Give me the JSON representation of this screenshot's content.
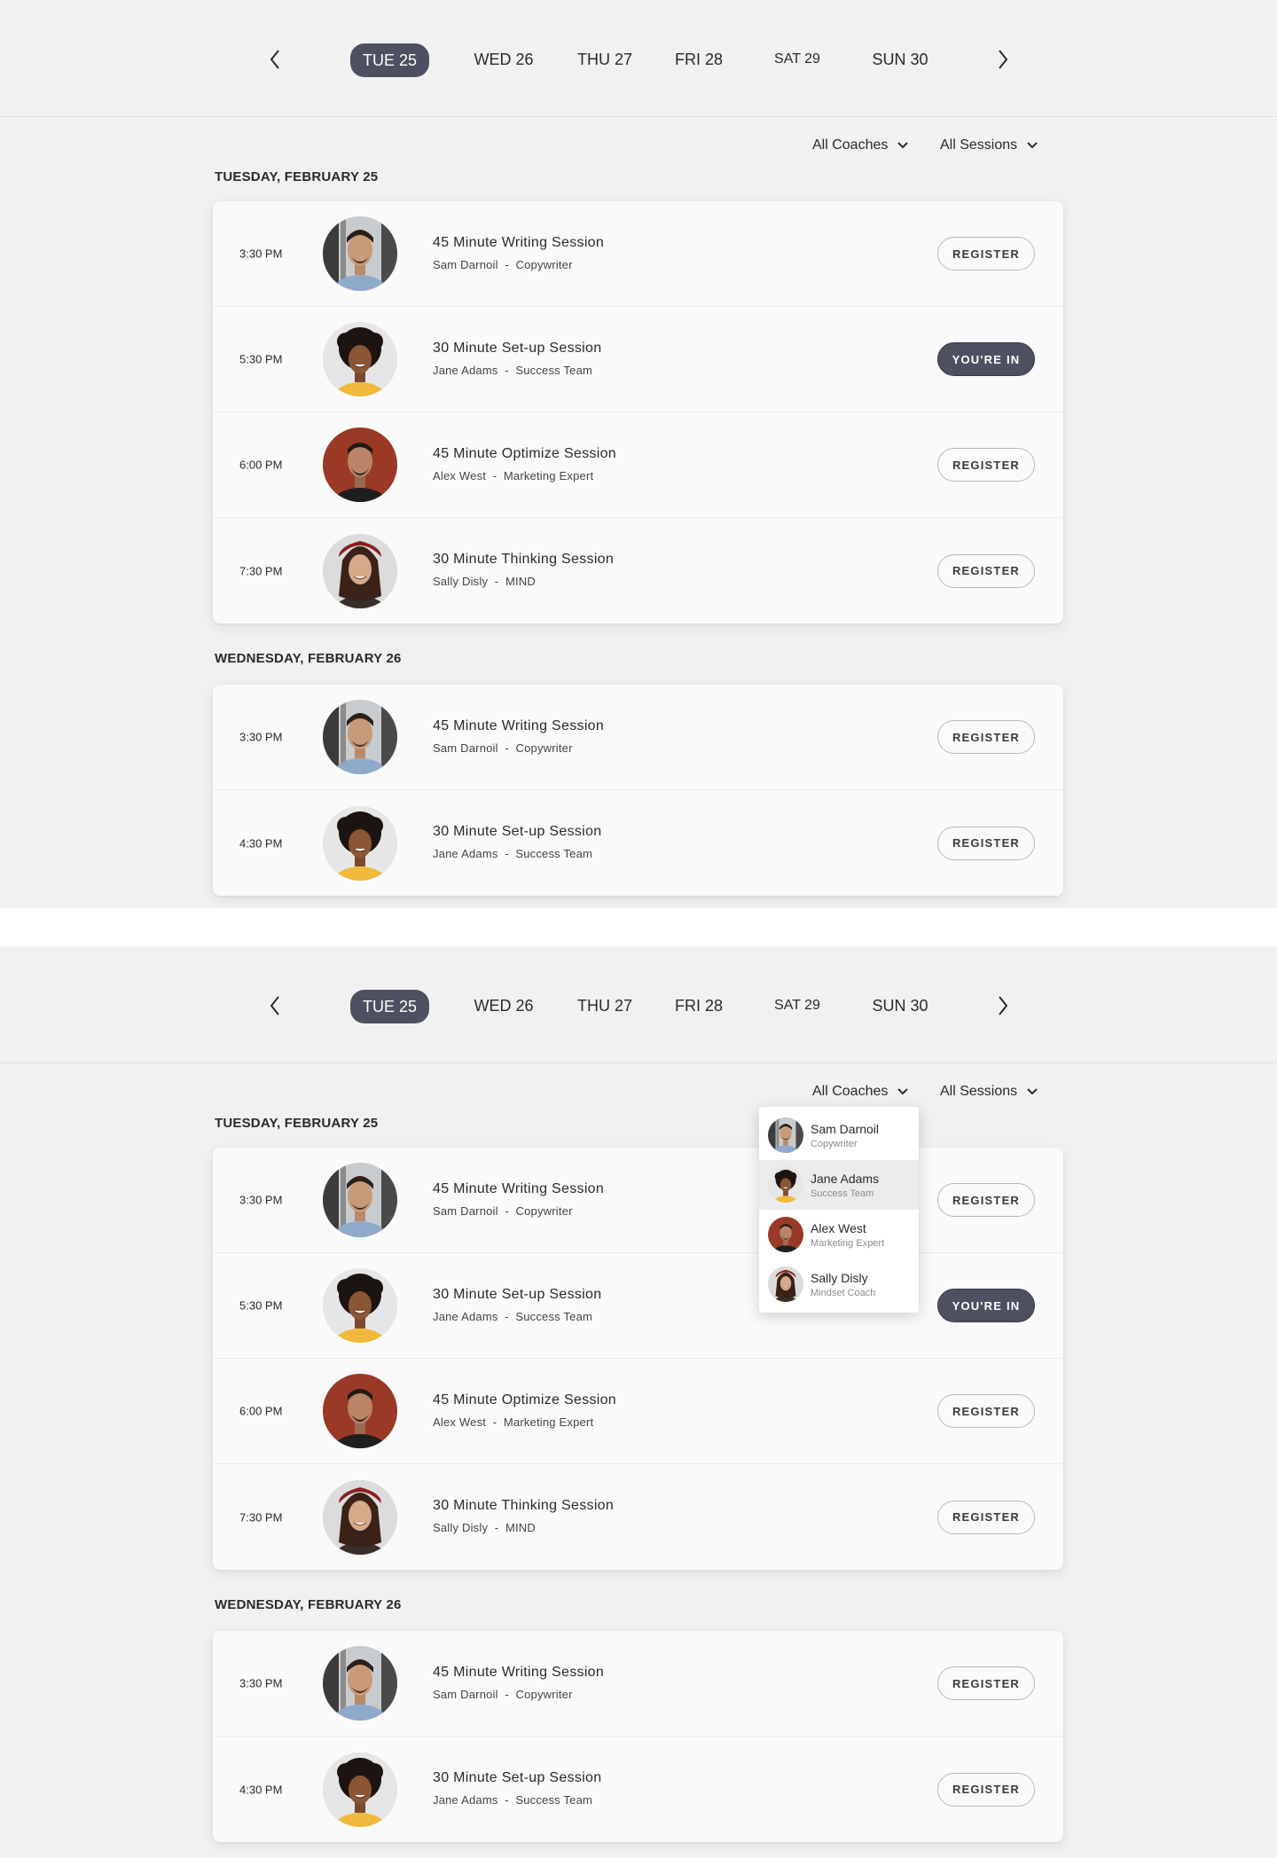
{
  "day_nav": {
    "days": [
      "TUE 25",
      "WED 26",
      "THU 27",
      "FRI 28",
      "SAT 29",
      "SUN 30"
    ],
    "active_index": 0
  },
  "filters": {
    "coaches_label": "All Coaches",
    "sessions_label": "All Sessions"
  },
  "schedule": [
    {
      "heading": "TUESDAY, FEBRUARY 25",
      "sessions": [
        {
          "time": "3:30 PM",
          "title": "45 Minute Writing Session",
          "coach": "Sam Darnoil",
          "sep": "-",
          "role": "Copywriter",
          "action": "REGISTER",
          "state": "register",
          "avatar": "sam"
        },
        {
          "time": "5:30 PM",
          "title": "30 Minute Set-up Session",
          "coach": "Jane Adams",
          "sep": "-",
          "role": "Success Team",
          "action": "YOU'RE IN",
          "state": "in",
          "avatar": "jane"
        },
        {
          "time": "6:00 PM",
          "title": "45 Minute Optimize Session",
          "coach": "Alex West",
          "sep": "-",
          "role": "Marketing Expert",
          "action": "REGISTER",
          "state": "register",
          "avatar": "alex"
        },
        {
          "time": "7:30 PM",
          "title": "30 Minute Thinking Session",
          "coach": "Sally Disly",
          "sep": "-",
          "role": "MIND",
          "action": "REGISTER",
          "state": "register",
          "avatar": "sally"
        }
      ]
    },
    {
      "heading": "WEDNESDAY, FEBRUARY 26",
      "sessions": [
        {
          "time": "3:30 PM",
          "title": "45 Minute Writing Session",
          "coach": "Sam Darnoil",
          "sep": "-",
          "role": "Copywriter",
          "action": "REGISTER",
          "state": "register",
          "avatar": "sam"
        },
        {
          "time": "4:30 PM",
          "title": "30 Minute Set-up Session",
          "coach": "Jane Adams",
          "sep": "-",
          "role": "Success Team",
          "action": "REGISTER",
          "state": "register",
          "avatar": "jane"
        }
      ]
    }
  ],
  "coach_dropdown": {
    "items": [
      {
        "name": "Sam Darnoil",
        "role": "Copywriter",
        "avatar": "sam"
      },
      {
        "name": "Jane Adams",
        "role": "Success Team",
        "avatar": "jane"
      },
      {
        "name": "Alex West",
        "role": "Marketing Expert",
        "avatar": "alex"
      },
      {
        "name": "Sally Disly",
        "role": "Mindset Coach",
        "avatar": "sally"
      }
    ],
    "hover_index": 1
  },
  "icons": {
    "prev": "chevron-left-icon",
    "next": "chevron-right-icon",
    "dropdown": "chevron-down-icon"
  },
  "colors": {
    "active_pill": "#4d5060",
    "page_bg": "#f1f1f2",
    "card_bg": "#fafafa"
  }
}
